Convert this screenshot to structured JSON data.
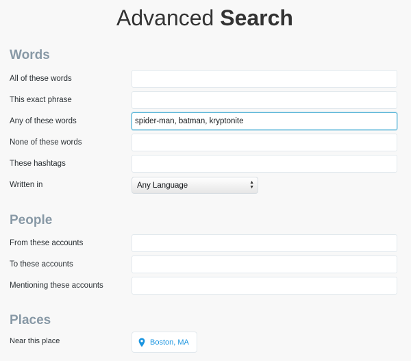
{
  "header": {
    "title_light": "Advanced",
    "title_bold": "Search"
  },
  "words": {
    "heading": "Words",
    "all_label": "All of these words",
    "all_value": "",
    "exact_label": "This exact phrase",
    "exact_value": "",
    "any_label": "Any of these words",
    "any_value": "spider-man, batman, kryptonite",
    "none_label": "None of these words",
    "none_value": "",
    "hashtags_label": "These hashtags",
    "hashtags_value": "",
    "language_label": "Written in",
    "language_value": "Any Language"
  },
  "people": {
    "heading": "People",
    "from_label": "From these accounts",
    "from_value": "",
    "to_label": "To these accounts",
    "to_value": "",
    "mentioning_label": "Mentioning these accounts",
    "mentioning_value": ""
  },
  "places": {
    "heading": "Places",
    "near_label": "Near this place",
    "near_value": "Boston, MA",
    "location_icon": "map-pin-icon"
  },
  "colors": {
    "accent": "#1b95e0",
    "heading": "#8899a6",
    "focus_border": "#56b4d8"
  }
}
